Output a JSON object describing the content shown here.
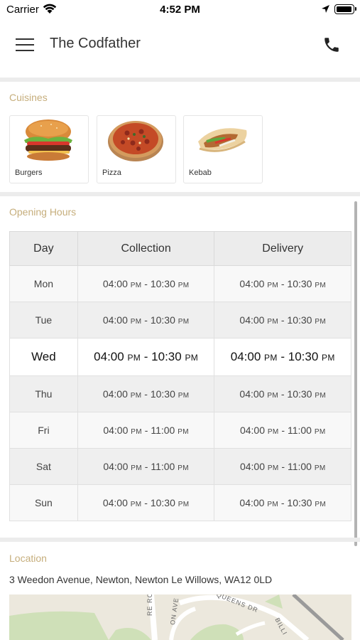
{
  "status_bar": {
    "carrier": "Carrier",
    "time": "4:52 PM"
  },
  "nav": {
    "title": "The Codfather"
  },
  "cuisines": {
    "label": "Cuisines",
    "items": [
      {
        "name": "Burgers",
        "icon": "burger-image"
      },
      {
        "name": "Pizza",
        "icon": "pizza-image"
      },
      {
        "name": "Kebab",
        "icon": "kebab-image"
      }
    ]
  },
  "opening_hours": {
    "label": "Opening Hours",
    "headers": [
      "Day",
      "Collection",
      "Delivery"
    ],
    "rows": [
      {
        "day": "Mon",
        "collection_open": "04:00",
        "collection_open_ampm": "PM",
        "collection_close": "10:30",
        "collection_close_ampm": "PM",
        "delivery_open": "04:00",
        "delivery_open_ampm": "PM",
        "delivery_close": "10:30",
        "delivery_close_ampm": "PM"
      },
      {
        "day": "Tue",
        "collection_open": "04:00",
        "collection_open_ampm": "PM",
        "collection_close": "10:30",
        "collection_close_ampm": "PM",
        "delivery_open": "04:00",
        "delivery_open_ampm": "PM",
        "delivery_close": "10:30",
        "delivery_close_ampm": "PM"
      },
      {
        "day": "Wed",
        "collection_open": "04:00",
        "collection_open_ampm": "PM",
        "collection_close": "10:30",
        "collection_close_ampm": "PM",
        "delivery_open": "04:00",
        "delivery_open_ampm": "PM",
        "delivery_close": "10:30",
        "delivery_close_ampm": "PM"
      },
      {
        "day": "Thu",
        "collection_open": "04:00",
        "collection_open_ampm": "PM",
        "collection_close": "10:30",
        "collection_close_ampm": "PM",
        "delivery_open": "04:00",
        "delivery_open_ampm": "PM",
        "delivery_close": "10:30",
        "delivery_close_ampm": "PM"
      },
      {
        "day": "Fri",
        "collection_open": "04:00",
        "collection_open_ampm": "PM",
        "collection_close": "11:00",
        "collection_close_ampm": "PM",
        "delivery_open": "04:00",
        "delivery_open_ampm": "PM",
        "delivery_close": "11:00",
        "delivery_close_ampm": "PM"
      },
      {
        "day": "Sat",
        "collection_open": "04:00",
        "collection_open_ampm": "PM",
        "collection_close": "11:00",
        "collection_close_ampm": "PM",
        "delivery_open": "04:00",
        "delivery_open_ampm": "PM",
        "delivery_close": "11:00",
        "delivery_close_ampm": "PM"
      },
      {
        "day": "Sun",
        "collection_open": "04:00",
        "collection_open_ampm": "PM",
        "collection_close": "10:30",
        "collection_close_ampm": "PM",
        "delivery_open": "04:00",
        "delivery_open_ampm": "PM",
        "delivery_close": "10:30",
        "delivery_close_ampm": "PM"
      }
    ],
    "highlighted_day": "Wed"
  },
  "location": {
    "label": "Location",
    "address": "3 Weedon Avenue, Newton, Newton Le Willows, WA12 0LD",
    "map_labels": {
      "queens": "QUEENS DR",
      "road": "RE ROAD",
      "on_ave": "ON AVE",
      "billy": "BILLI"
    }
  },
  "colors": {
    "section_label": "#c6ae7c",
    "divider": "#ececec"
  }
}
